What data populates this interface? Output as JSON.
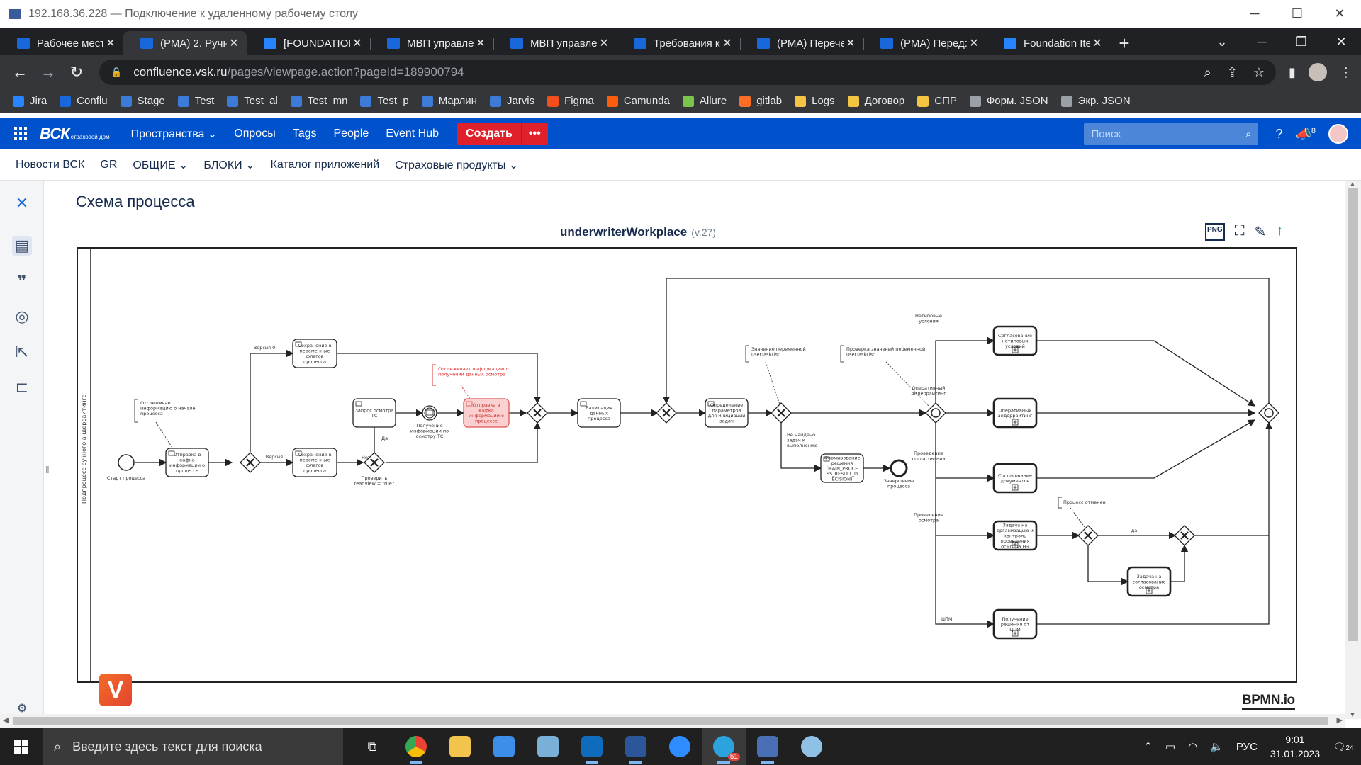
{
  "rdp": {
    "title": "192.168.36.228 — Подключение к удаленному рабочему столу"
  },
  "tabs": [
    {
      "label": "Рабочее мест",
      "color": "#1868db"
    },
    {
      "label": "(РМА) 2. Ручн",
      "color": "#1868db",
      "active": true
    },
    {
      "label": "[FOUNDATION",
      "color": "#2684ff"
    },
    {
      "label": "МВП управле",
      "color": "#1868db"
    },
    {
      "label": "МВП управле",
      "color": "#1868db"
    },
    {
      "label": "Требования к",
      "color": "#1868db"
    },
    {
      "label": "(РМА) Перечe",
      "color": "#1868db"
    },
    {
      "label": "(РМА) Перед:",
      "color": "#1868db"
    },
    {
      "label": "Foundation Ite",
      "color": "#2684ff"
    }
  ],
  "address": {
    "host": "confluence.vsk.ru",
    "path": "/pages/viewpage.action?pageId=189900794"
  },
  "bookmarks": [
    {
      "label": "Jira",
      "color": "#2684ff"
    },
    {
      "label": "Conflu",
      "color": "#1868db"
    },
    {
      "label": "Stage",
      "color": "#3d7bd9"
    },
    {
      "label": "Test",
      "color": "#3d7bd9"
    },
    {
      "label": "Test_al",
      "color": "#3d7bd9"
    },
    {
      "label": "Test_mn",
      "color": "#3d7bd9"
    },
    {
      "label": "Test_p",
      "color": "#3d7bd9"
    },
    {
      "label": "Марлин",
      "color": "#3d7bd9"
    },
    {
      "label": "Jarvis",
      "color": "#3d7bd9"
    },
    {
      "label": "Figma",
      "color": "#f24e1e"
    },
    {
      "label": "Camunda",
      "color": "#fc5d0d"
    },
    {
      "label": "Allure",
      "color": "#7bc34a"
    },
    {
      "label": "gitlab",
      "color": "#fc6d26"
    },
    {
      "label": "Logs",
      "color": "#f4c542"
    },
    {
      "label": "Договор",
      "color": "#f4c542"
    },
    {
      "label": "СПР",
      "color": "#f4c542"
    },
    {
      "label": "Форм. JSON",
      "color": "#9aa0a6"
    },
    {
      "label": "Экр. JSON",
      "color": "#9aa0a6"
    }
  ],
  "header": {
    "logo": "ВСК",
    "logo_sub": "страховой дом",
    "nav": [
      "Пространства",
      "Опросы",
      "Tags",
      "People",
      "Event Hub"
    ],
    "create": "Создать",
    "more": "•••",
    "search_placeholder": "Поиск",
    "notif_count": "8"
  },
  "space_nav": [
    "Новости ВСК",
    "GR",
    "ОБЩИЕ",
    "БЛОКИ",
    "Каталог приложений",
    "Страховые продукты"
  ],
  "page": {
    "title": "Схема процесса",
    "diagram_name": "underwriterWorkplace",
    "diagram_version": "(v.27)",
    "png_label": "PNG",
    "bpmn_logo": "BPMN.io",
    "v_logo": "V"
  },
  "diagram": {
    "pool_label": "Подпроцесс ручного андеррайтинга",
    "start_label": "Старт процесса",
    "annot_start": [
      "Отслеживает",
      "информацию о начале",
      "процесса"
    ],
    "task_send_kafka": [
      "Отправка в",
      "кафка",
      "информации о",
      "процессе"
    ],
    "version0": "Версия 0",
    "version1": "Версия 1",
    "task_save_flags_top": [
      "Сохранение в",
      "переменные",
      "флагов",
      "процесса"
    ],
    "task_save_flags_bottom": [
      "Сохранение в",
      "переменные",
      "флагов",
      "процесса"
    ],
    "task_request_inspect": [
      "Запрос осмотра",
      "ТС"
    ],
    "gw_check_label": [
      "Проверить",
      "readView = true?"
    ],
    "yes": "Да",
    "no": "Нет",
    "msg_event_label": [
      "Получение",
      "информации по",
      "осмотру ТС"
    ],
    "annot_red": [
      "Отслеживает информацию о",
      "получении данных осмотра"
    ],
    "task_red": [
      "Отправка в",
      "кафка",
      "информации о",
      "процессе"
    ],
    "task_validation": [
      "Валидация",
      "данных",
      "процесса"
    ],
    "annot_var1": [
      "Значение переменной",
      "userTaskList"
    ],
    "annot_var2": [
      "Проверка значений переменной",
      "userTaskList"
    ],
    "task_params": [
      "Определение",
      "параметров",
      "для инициации",
      "задач"
    ],
    "not_found": [
      "Не найдено",
      "задач к",
      "выполнению"
    ],
    "task_decision": [
      "Формирование",
      "решения",
      "(MAIN_PROCE",
      "SS_RESULT_D",
      "ECISION)"
    ],
    "end_label": [
      "Завершение",
      "процесса"
    ],
    "branch_nonstandard": [
      "Нетиповые",
      "условия"
    ],
    "branch_operative": [
      "Оперативный",
      "Андеррайтинг"
    ],
    "branch_docs": [
      "Проведение",
      "согласования"
    ],
    "branch_inspect": [
      "Проведение",
      "осмотра"
    ],
    "branch_cpm": "ЦПМ",
    "task_nonstandard": [
      "Согласование",
      "нетиповых",
      "условий"
    ],
    "task_operative": [
      "Оперативный",
      "андеррайтинг"
    ],
    "task_docs": [
      "Согласование",
      "документов"
    ],
    "task_inspect": [
      "Задача на",
      "организацию и",
      "контроль",
      "проведения",
      "осмотра НЭ"
    ],
    "annot_cancel": "Процесс отменен",
    "da": "да",
    "task_approve_inspect": [
      "Задача на",
      "согласование",
      "осмотра"
    ],
    "task_cpm": [
      "Получение",
      "решения от",
      "ЦПМ"
    ]
  },
  "taskbar": {
    "search_placeholder": "Введите здесь текст для поиска",
    "lang": "РУС",
    "time": "9:01",
    "date": "31.01.2023",
    "notif": "24",
    "telegram_badge": "51"
  }
}
